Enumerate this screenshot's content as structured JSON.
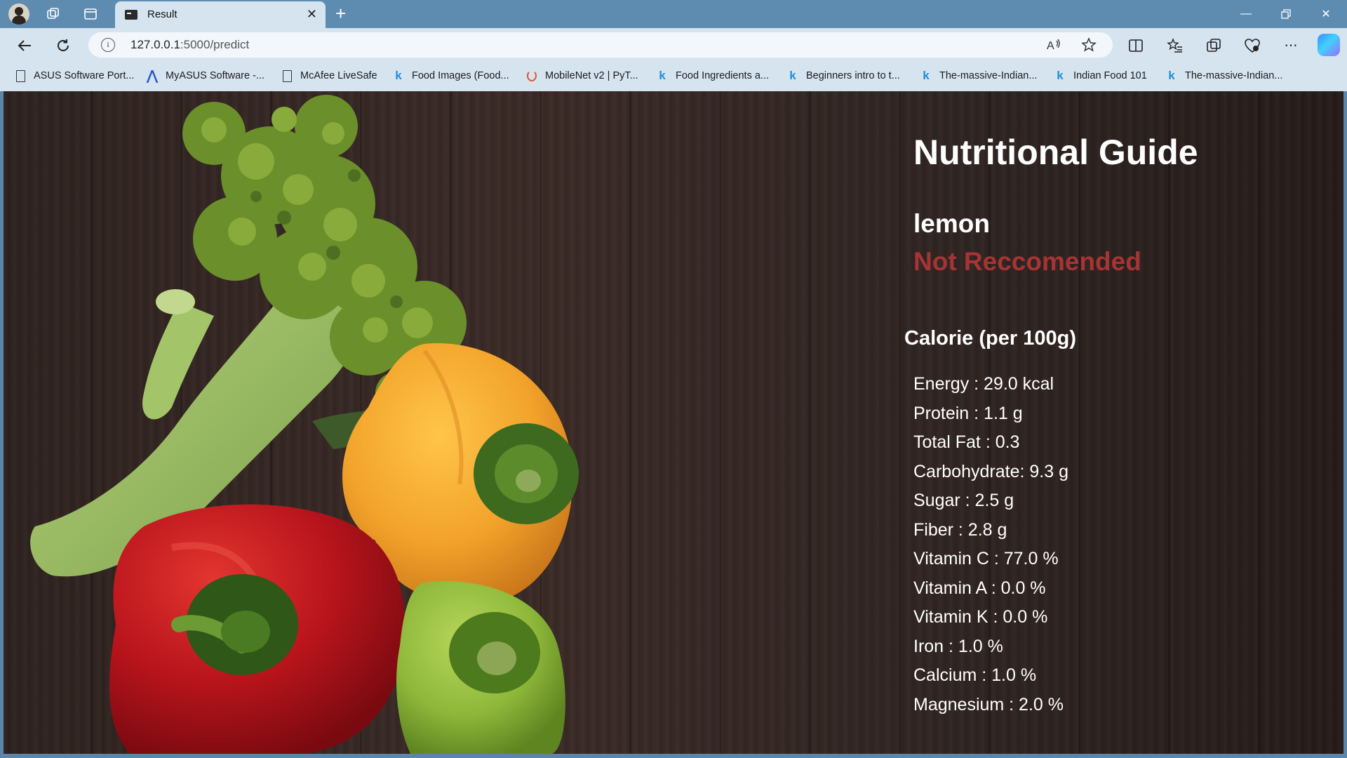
{
  "browser": {
    "tab_title": "Result",
    "url_host": "127.0.0.1",
    "url_rest": ":5000/predict",
    "bookmarks": [
      {
        "label": "ASUS Software Port...",
        "icon": "page-icon"
      },
      {
        "label": "MyASUS Software -...",
        "icon": "asus-icon"
      },
      {
        "label": "McAfee LiveSafe",
        "icon": "page-icon"
      },
      {
        "label": "Food Images (Food...",
        "icon": "kaggle-icon"
      },
      {
        "label": "MobileNet v2 | PyT...",
        "icon": "pytorch-icon"
      },
      {
        "label": "Food Ingredients a...",
        "icon": "kaggle-icon"
      },
      {
        "label": "Beginners intro to t...",
        "icon": "kaggle-icon"
      },
      {
        "label": "The-massive-Indian...",
        "icon": "kaggle-icon"
      },
      {
        "label": "Indian Food 101",
        "icon": "kaggle-icon"
      },
      {
        "label": "The-massive-Indian...",
        "icon": "kaggle-icon"
      }
    ]
  },
  "page": {
    "title": "Nutritional Guide",
    "food_name": "lemon",
    "verdict": "Not Reccomended",
    "verdict_color": "#a63434",
    "calorie_heading": "Calorie (per 100g)",
    "nutrients": [
      "Energy : 29.0 kcal",
      "Protein : 1.1 g",
      "Total Fat : 0.3",
      "Carbohydrate: 9.3 g",
      "Sugar : 2.5 g",
      "Fiber : 2.8 g",
      "Vitamin C : 77.0 %",
      "Vitamin A : 0.0 %",
      "Vitamin K : 0.0 %",
      "Iron : 1.0 %",
      "Calcium : 1.0 %",
      "Magnesium : 2.0 %"
    ]
  }
}
